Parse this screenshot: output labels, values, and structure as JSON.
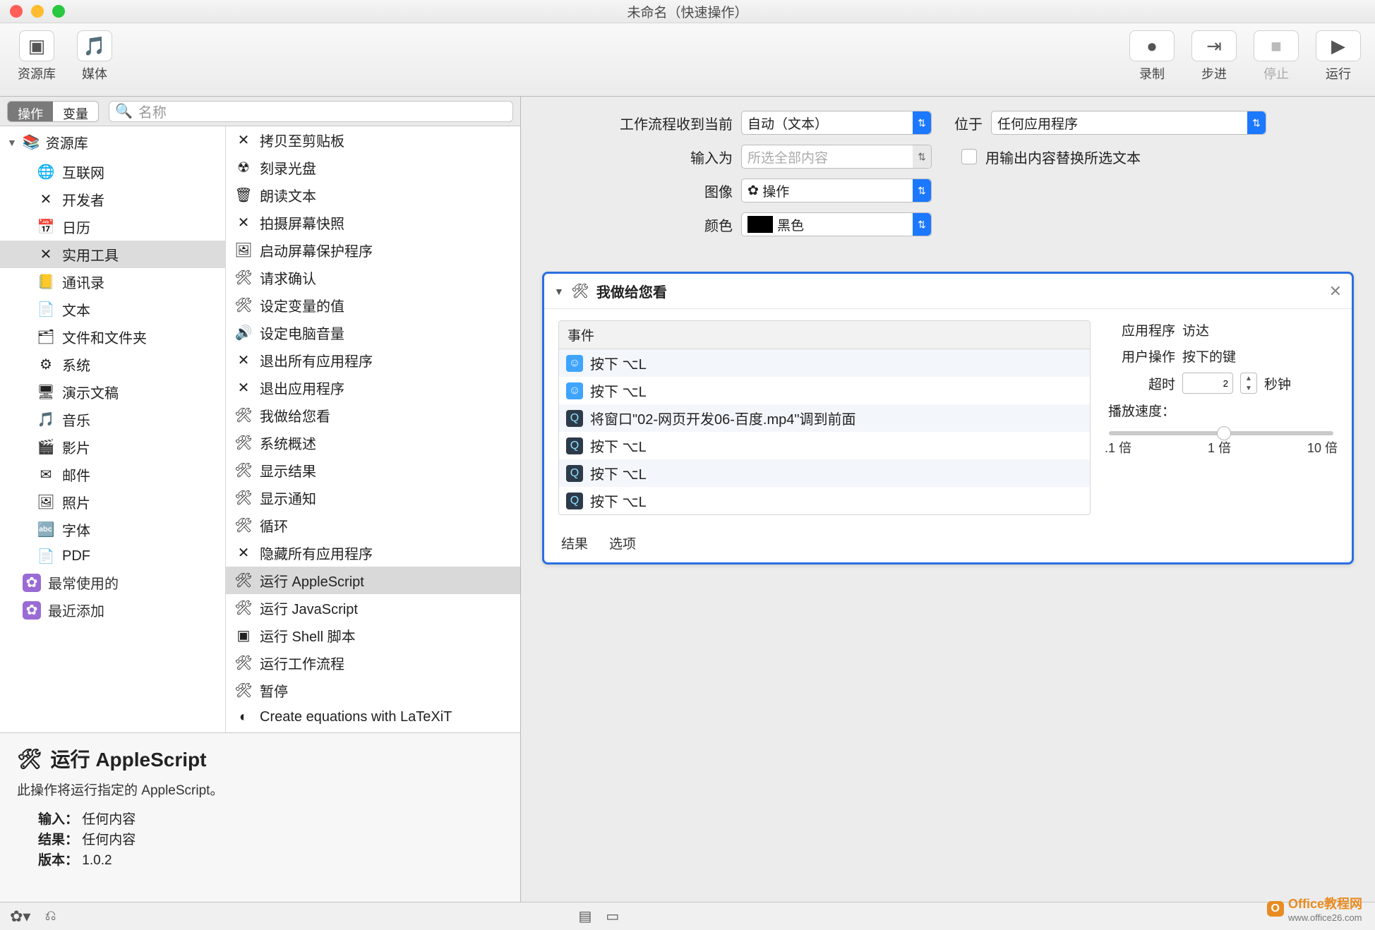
{
  "window": {
    "title": "未命名（快速操作）"
  },
  "toolbar": {
    "library": "资源库",
    "media": "媒体",
    "record": "录制",
    "step": "步进",
    "stop": "停止",
    "run": "运行"
  },
  "tabs": {
    "actions": "操作",
    "variables": "变量"
  },
  "search": {
    "placeholder": "名称"
  },
  "library_root": "资源库",
  "categories": [
    {
      "label": "互联网",
      "icon": "🌐"
    },
    {
      "label": "开发者",
      "icon": "✕"
    },
    {
      "label": "日历",
      "icon": "📅"
    },
    {
      "label": "实用工具",
      "icon": "✕",
      "selected": true
    },
    {
      "label": "通讯录",
      "icon": "📒"
    },
    {
      "label": "文本",
      "icon": "📄"
    },
    {
      "label": "文件和文件夹",
      "icon": "🗂"
    },
    {
      "label": "系统",
      "icon": "⚙"
    },
    {
      "label": "演示文稿",
      "icon": "🖥"
    },
    {
      "label": "音乐",
      "icon": "🎵"
    },
    {
      "label": "影片",
      "icon": "🎬"
    },
    {
      "label": "邮件",
      "icon": "✉"
    },
    {
      "label": "照片",
      "icon": "🖼"
    },
    {
      "label": "字体",
      "icon": "🔤"
    },
    {
      "label": "PDF",
      "icon": "📄"
    }
  ],
  "smart": [
    {
      "label": "最常使用的"
    },
    {
      "label": "最近添加"
    }
  ],
  "actions_list": [
    {
      "label": "拷贝至剪贴板",
      "icon": "✕"
    },
    {
      "label": "刻录光盘",
      "icon": "☢"
    },
    {
      "label": "朗读文本",
      "icon": "🗑"
    },
    {
      "label": "拍摄屏幕快照",
      "icon": "✕"
    },
    {
      "label": "启动屏幕保护程序",
      "icon": "🖼"
    },
    {
      "label": "请求确认",
      "icon": "🛠"
    },
    {
      "label": "设定变量的值",
      "icon": "🛠"
    },
    {
      "label": "设定电脑音量",
      "icon": "🔊"
    },
    {
      "label": "退出所有应用程序",
      "icon": "✕"
    },
    {
      "label": "退出应用程序",
      "icon": "✕"
    },
    {
      "label": "我做给您看",
      "icon": "🛠"
    },
    {
      "label": "系统概述",
      "icon": "🛠"
    },
    {
      "label": "显示结果",
      "icon": "🛠"
    },
    {
      "label": "显示通知",
      "icon": "🛠"
    },
    {
      "label": "循环",
      "icon": "🛠"
    },
    {
      "label": "隐藏所有应用程序",
      "icon": "✕"
    },
    {
      "label": "运行 AppleScript",
      "icon": "🛠",
      "selected": true
    },
    {
      "label": "运行 JavaScript",
      "icon": "🛠"
    },
    {
      "label": "运行 Shell 脚本",
      "icon": "▣"
    },
    {
      "label": "运行工作流程",
      "icon": "🛠"
    },
    {
      "label": "暂停",
      "icon": "🛠"
    },
    {
      "label": "Create equations with LaTeXiT",
      "icon": "◐"
    }
  ],
  "description": {
    "title": "运行 AppleScript",
    "subtitle": "此操作将运行指定的 AppleScript。",
    "input_label": "输入：",
    "input_value": "任何内容",
    "result_label": "结果：",
    "result_value": "任何内容",
    "version_label": "版本：",
    "version_value": "1.0.2"
  },
  "config": {
    "receives_label": "工作流程收到当前",
    "receives_value": "自动（文本）",
    "in_label": "位于",
    "in_value": "任何应用程序",
    "input_as_label": "输入为",
    "input_as_value": "所选全部内容",
    "replace_label": "用输出内容替换所选文本",
    "image_label": "图像",
    "image_value": "操作",
    "color_label": "颜色",
    "color_value": "黑色"
  },
  "wfaction": {
    "title": "我做给您看",
    "event_header": "事件",
    "events": [
      {
        "icon": "finder",
        "text": "按下 ⌥L"
      },
      {
        "icon": "finder",
        "text": "按下 ⌥L"
      },
      {
        "icon": "qt",
        "text": "将窗口\"02-网页开发06-百度.mp4\"调到前面"
      },
      {
        "icon": "qt",
        "text": "按下 ⌥L"
      },
      {
        "icon": "qt",
        "text": "按下 ⌥L"
      },
      {
        "icon": "qt",
        "text": "按下 ⌥L"
      }
    ],
    "app_label": "应用程序",
    "app_value": "访达",
    "user_label": "用户操作",
    "user_value": "按下的键",
    "timeout_label": "超时",
    "timeout_value": "2",
    "timeout_unit": "秒钟",
    "speed_label": "播放速度：",
    "speed_marks": [
      ".1 倍",
      "1 倍",
      "10 倍"
    ],
    "tab_result": "结果",
    "tab_options": "选项"
  },
  "watermark": {
    "brand": "Office教程网",
    "url": "www.office26.com"
  }
}
